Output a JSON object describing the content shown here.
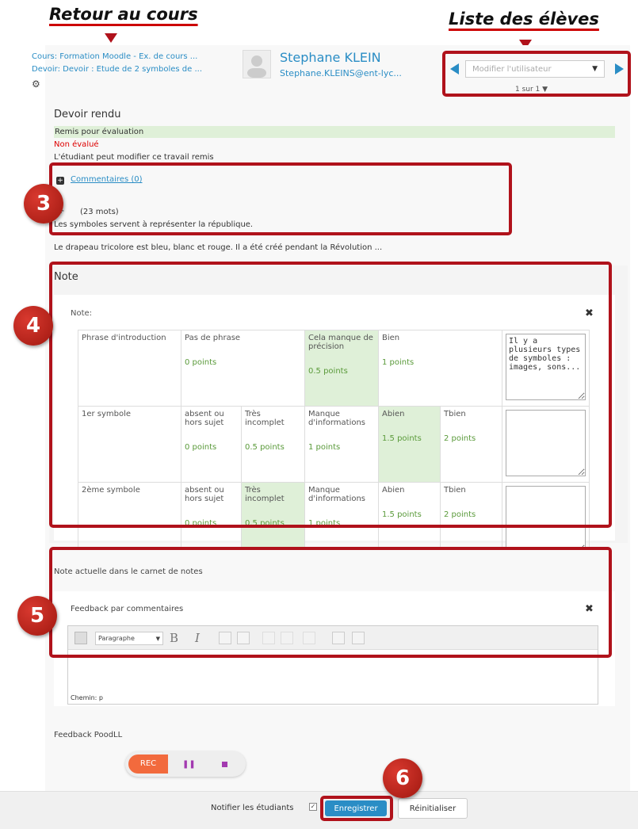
{
  "annotations": {
    "back_to_course": "Retour au cours",
    "student_list": "Liste des élèves",
    "badge3": "3",
    "badge4": "4",
    "badge5": "5",
    "badge6": "6"
  },
  "header": {
    "course_link": "Cours: Formation Moodle - Ex. de cours ...",
    "assignment_link": "Devoir: Devoir : Etude de 2 symboles de ...",
    "student_name": "Stephane KLEIN",
    "student_email": "Stephane.KLEINS@ent-lyc...",
    "user_select": "Modifier l'utilisateur",
    "pager": "1 sur 1"
  },
  "submission": {
    "title": "Devoir rendu",
    "status": "Remis pour évaluation",
    "grading_status": "Non évalué",
    "edit_note": "L'étudiant peut modifier ce travail remis",
    "comments_link": "Commentaires (0)",
    "word_count": "(23 mots)",
    "text_line1": "Les symboles servent à représenter la république.",
    "text_line2": "Le drapeau tricolore est bleu, blanc et rouge. Il a été créé pendant la Révolution ..."
  },
  "grade": {
    "section_title": "Note",
    "label": "Note:",
    "rubric": [
      {
        "criterion": "Phrase d'introduction",
        "levels": [
          {
            "desc": "Pas de phrase",
            "points": "0 points",
            "selected": false
          },
          {
            "desc": "Cela manque de précision",
            "points": "0.5 points",
            "selected": true
          },
          {
            "desc": "Bien",
            "points": "1 points",
            "selected": false
          }
        ],
        "remark": "Il y a plusieurs types de symboles : images, sons..."
      },
      {
        "criterion": "1er symbole",
        "levels": [
          {
            "desc": "absent ou hors sujet",
            "points": "0 points",
            "selected": false
          },
          {
            "desc": "Très incomplet",
            "points": "0.5 points",
            "selected": false
          },
          {
            "desc": "Manque d'informations",
            "points": "1 points",
            "selected": false
          },
          {
            "desc": "Abien",
            "points": "1.5 points",
            "selected": true
          },
          {
            "desc": "Tbien",
            "points": "2 points",
            "selected": false
          }
        ],
        "remark": ""
      },
      {
        "criterion": "2ème symbole",
        "levels": [
          {
            "desc": "absent ou hors sujet",
            "points": "0 points",
            "selected": false
          },
          {
            "desc": "Très incomplet",
            "points": "0.5 points",
            "selected": true
          },
          {
            "desc": "Manque d'informations",
            "points": "1 points",
            "selected": false
          },
          {
            "desc": "Abien",
            "points": "1.5 points",
            "selected": false
          },
          {
            "desc": "Tbien",
            "points": "2 points",
            "selected": false
          }
        ],
        "remark": ""
      }
    ]
  },
  "feedback": {
    "current_grade": "Note actuelle dans le carnet de notes",
    "comments_label": "Feedback par commentaires",
    "format_select": "Paragraphe",
    "path": "Chemin: p",
    "poodll_label": "Feedback PoodLL",
    "rec": "REC"
  },
  "footer": {
    "notify": "Notifier les étudiants",
    "save": "Enregistrer",
    "reset": "Réinitialiser"
  }
}
